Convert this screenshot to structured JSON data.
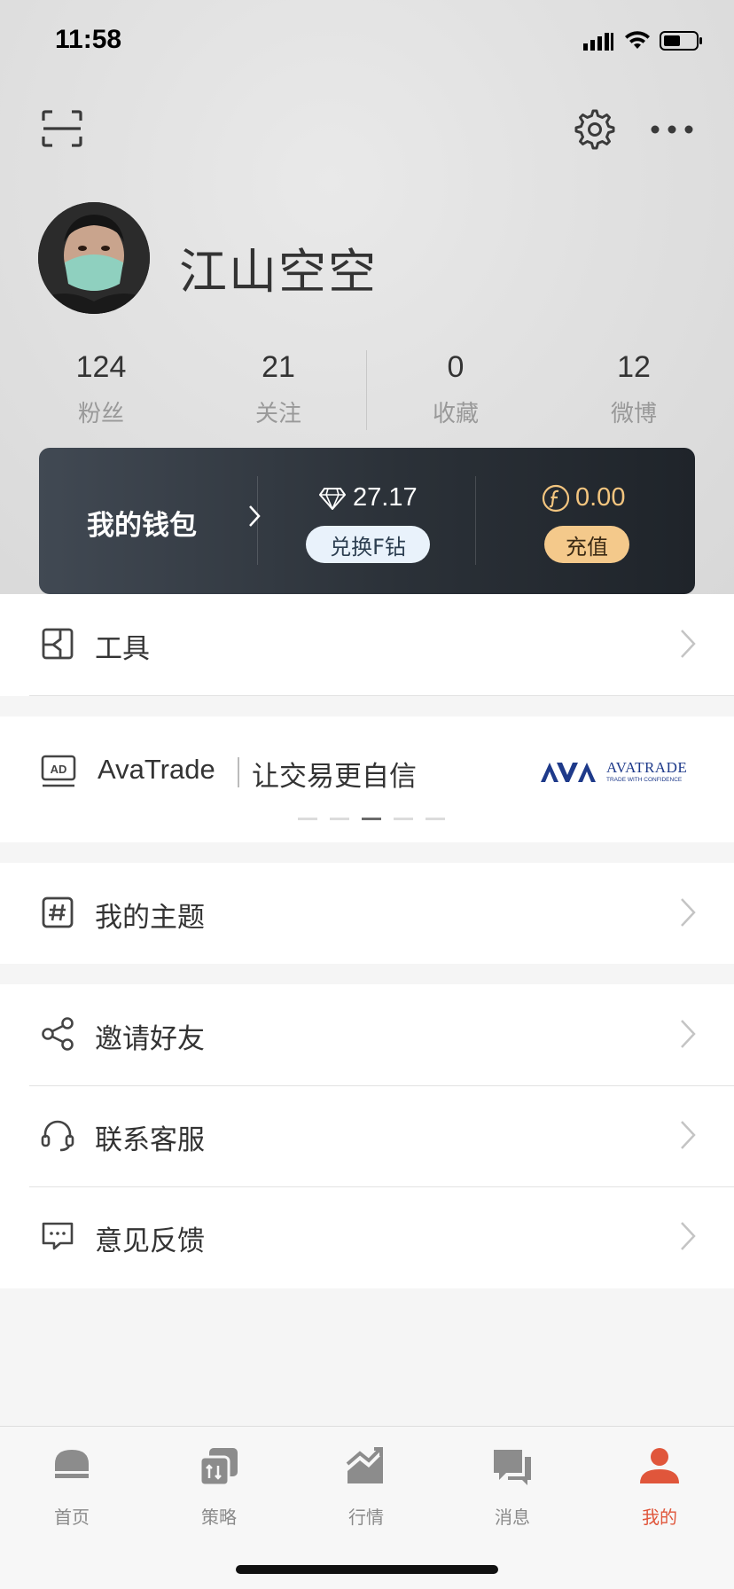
{
  "status_bar": {
    "time": "11:58"
  },
  "profile": {
    "username": "江山空空"
  },
  "stats": [
    {
      "value": "124",
      "label": "粉丝"
    },
    {
      "value": "21",
      "label": "关注"
    },
    {
      "value": "0",
      "label": "收藏"
    },
    {
      "value": "12",
      "label": "微博"
    }
  ],
  "wallet": {
    "title": "我的钱包",
    "diamond_value": "27.17",
    "exchange_label": "兑换F钻",
    "coin_value": "0.00",
    "recharge_label": "充值",
    "accent_color": "#f4c98b"
  },
  "menu": {
    "tools": "工具",
    "ad_brand": "AvaTrade",
    "ad_slogan": "让交易更自信",
    "ad_badge": "AD",
    "ad_logo_text": "AVATRADE",
    "ad_logo_sub": "TRADE WITH CONFIDENCE",
    "my_topics": "我的主题",
    "invite_friends": "邀请好友",
    "contact_service": "联系客服",
    "feedback": "意见反馈"
  },
  "carousel": {
    "count": 5,
    "active_index": 2
  },
  "tabbar": {
    "items": [
      {
        "label": "首页",
        "icon": "home-icon"
      },
      {
        "label": "策略",
        "icon": "strategy-icon"
      },
      {
        "label": "行情",
        "icon": "market-icon"
      },
      {
        "label": "消息",
        "icon": "message-icon"
      },
      {
        "label": "我的",
        "icon": "profile-icon"
      }
    ],
    "active_index": 4,
    "active_color": "#e0563b"
  }
}
